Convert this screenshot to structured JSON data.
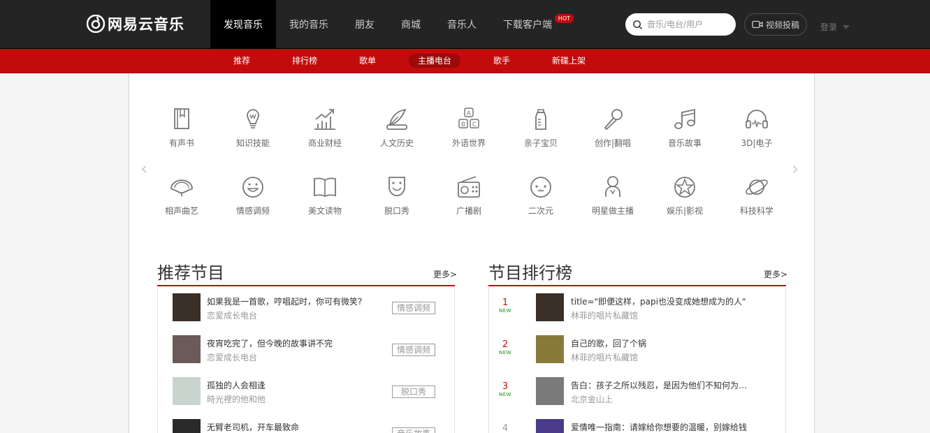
{
  "logo": {
    "text": "网易云音乐"
  },
  "nav": {
    "items": [
      {
        "label": "发现音乐",
        "active": true
      },
      {
        "label": "我的音乐"
      },
      {
        "label": "朋友"
      },
      {
        "label": "商城"
      },
      {
        "label": "音乐人"
      },
      {
        "label": "下载客户端",
        "badge": "HOT"
      }
    ]
  },
  "search": {
    "placeholder": "音乐/电台/用户"
  },
  "video_button": {
    "label": "视频投稿"
  },
  "login": {
    "label": "登录"
  },
  "subnav": {
    "items": [
      {
        "label": "推荐"
      },
      {
        "label": "排行榜"
      },
      {
        "label": "歌单"
      },
      {
        "label": "主播电台",
        "active": true
      },
      {
        "label": "歌手"
      },
      {
        "label": "新碟上架"
      }
    ]
  },
  "categories": [
    {
      "label": "有声书",
      "icon": "book-icon"
    },
    {
      "label": "知识技能",
      "icon": "bulb-icon"
    },
    {
      "label": "商业财经",
      "icon": "chart-icon"
    },
    {
      "label": "人文历史",
      "icon": "quill-icon"
    },
    {
      "label": "外语世界",
      "icon": "abc-icon"
    },
    {
      "label": "亲子宝贝",
      "icon": "bottle-icon"
    },
    {
      "label": "创作|翻唱",
      "icon": "mic-icon"
    },
    {
      "label": "音乐故事",
      "icon": "music-note-icon"
    },
    {
      "label": "3D|电子",
      "icon": "headphones-icon"
    },
    {
      "label": "相声曲艺",
      "icon": "fan-icon"
    },
    {
      "label": "情感调频",
      "icon": "smile-icon"
    },
    {
      "label": "美文读物",
      "icon": "open-book-icon"
    },
    {
      "label": "脱口秀",
      "icon": "mask-icon"
    },
    {
      "label": "广播剧",
      "icon": "radio-icon"
    },
    {
      "label": "二次元",
      "icon": "cute-face-icon"
    },
    {
      "label": "明星做主播",
      "icon": "star-person-icon"
    },
    {
      "label": "娱乐|影视",
      "icon": "star-icon"
    },
    {
      "label": "科技科学",
      "icon": "planet-icon"
    }
  ],
  "arrows": {
    "prev": "‹",
    "next": "›"
  },
  "recommended": {
    "title": "推荐节目",
    "more": "更多>",
    "items": [
      {
        "title": "如果我是一首歌，哼唱起时，你可有微笑?",
        "sub": "恋爱成长电台",
        "tag": "情感调频",
        "thumb_color": "#3a3028"
      },
      {
        "title": "夜宵吃完了，但今晚的故事讲不完",
        "sub": "恋爱成长电台",
        "tag": "情感调频",
        "thumb_color": "#6b5a58"
      },
      {
        "title": "孤独的人会相逢",
        "sub": "時光裡的他和他",
        "tag": "脱口秀",
        "thumb_color": "#c9d4cf"
      },
      {
        "title": "无臂老司机，开车最致命",
        "sub": "",
        "tag": "音乐故事",
        "thumb_color": "#2a2a2a"
      }
    ]
  },
  "ranking": {
    "title": "节目排行榜",
    "more": "更多>",
    "items": [
      {
        "rank": "1",
        "new": "NEW",
        "title": "title=\"即便这样，papi也没变成她想成为的人\"",
        "sub": "林菲的唱片私藏馆",
        "thumb_color": "#3a3028"
      },
      {
        "rank": "2",
        "new": "NEW",
        "title": "自己的歌，回了个锅",
        "sub": "林菲的唱片私藏馆",
        "thumb_color": "#8a7a3a"
      },
      {
        "rank": "3",
        "new": "NEW",
        "title": "告白：孩子之所以残忍，是因为他们不知何为…",
        "sub": "北京金山上",
        "thumb_color": "#7a7a7a"
      },
      {
        "rank": "4",
        "new": "",
        "title": "爱情唯一指南：请嫁给你想要的温暖，别嫁给钱",
        "sub": "",
        "thumb_color": "#4a3a8a"
      }
    ]
  }
}
